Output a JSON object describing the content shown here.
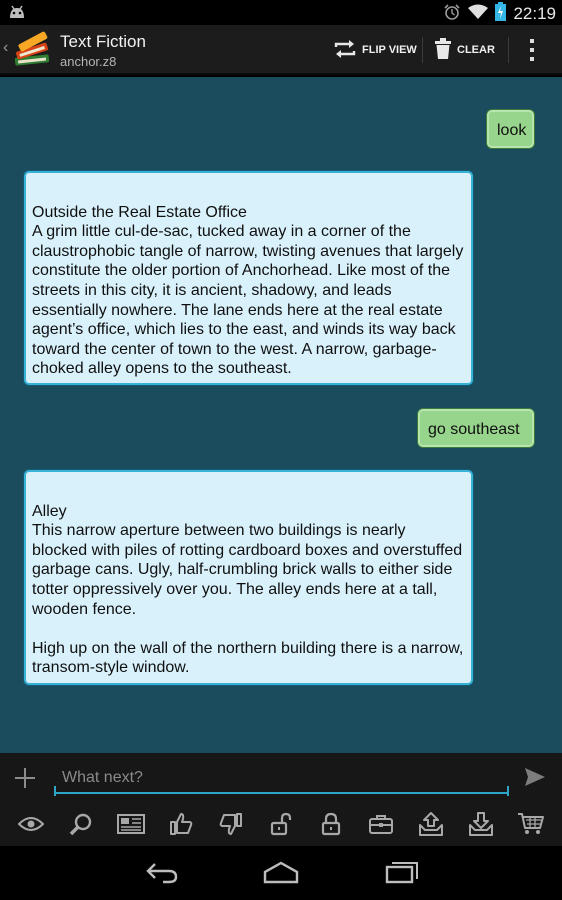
{
  "status_bar": {
    "time": "22:19",
    "icons": [
      "android-notification-icon",
      "alarm-icon",
      "wifi-icon",
      "battery-charging-icon"
    ]
  },
  "action_bar": {
    "title": "Text Fiction",
    "subtitle": "anchor.z8",
    "flip_view_label": "FLIP VIEW",
    "clear_label": "CLEAR"
  },
  "messages": [
    {
      "role": "user",
      "text": "look"
    },
    {
      "role": "story",
      "text": "\nOutside the Real Estate Office\nA grim little cul-de-sac, tucked away in a corner of the claustrophobic tangle of narrow, twisting avenues that largely constitute the older portion of Anchorhead. Like most of the streets in this city, it is ancient, shadowy, and leads essentially nowhere. The lane ends here at the real estate agent’s office, which lies to the east, and winds its way back toward the center of town to the west. A narrow, garbage-choked alley opens to the southeast."
    },
    {
      "role": "user",
      "text": "go southeast"
    },
    {
      "role": "story",
      "text": "\nAlley\nThis narrow aperture between two buildings is nearly blocked with piles of rotting cardboard boxes and overstuffed garbage cans. Ugly, half-crumbling brick walls to either side totter oppressively over you. The alley ends here at a tall, wooden fence.\n\nHigh up on the wall of the northern building there is a narrow, transom-style window."
    }
  ],
  "input": {
    "placeholder": "What next?",
    "value": ""
  },
  "command_icons": [
    "look-eye-icon",
    "search-magnifier-icon",
    "read-newspaper-icon",
    "thumbs-up-icon",
    "thumbs-down-icon",
    "unlock-icon",
    "lock-icon",
    "inventory-case-icon",
    "put-down-icon",
    "pick-up-icon",
    "shopping-cart-icon"
  ],
  "colors": {
    "chat_background": "#1b4c5e",
    "user_bubble": "#97d48c",
    "story_bubble": "#d9f1fb",
    "story_border": "#38b2d6",
    "input_accent": "#2ea5c8"
  }
}
